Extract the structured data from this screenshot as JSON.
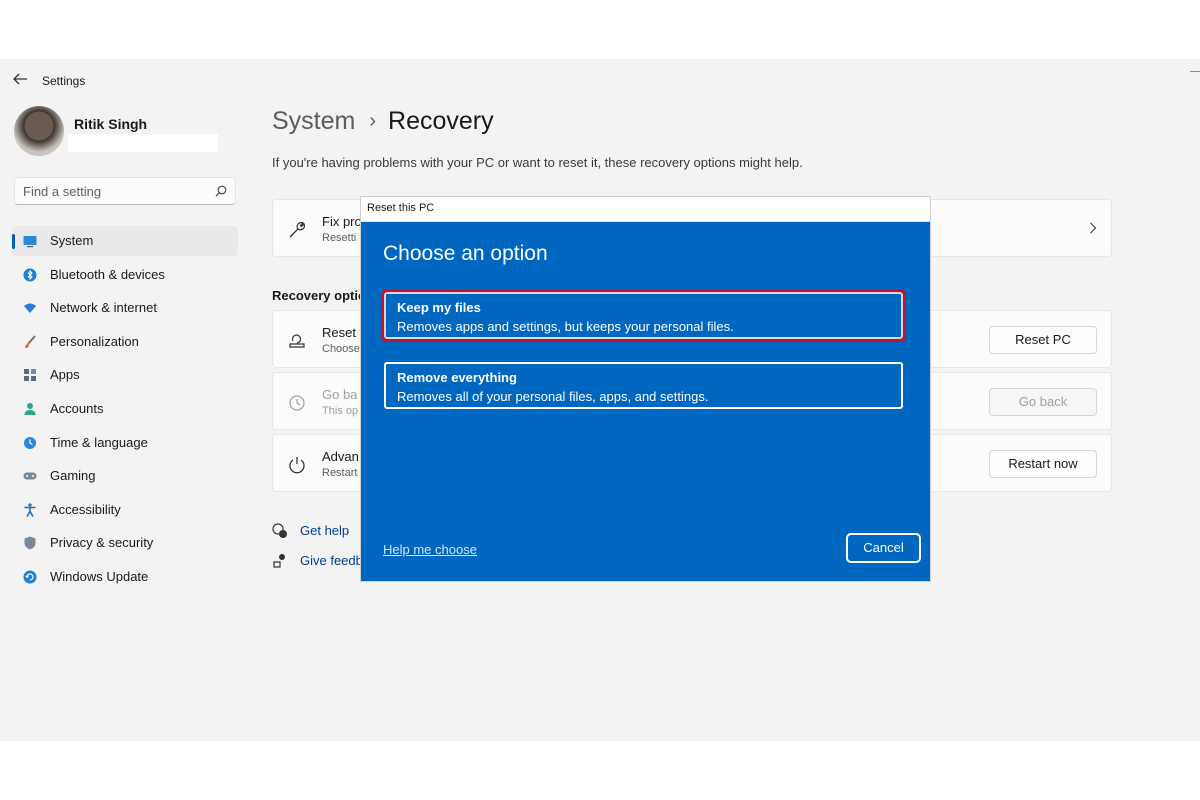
{
  "app": {
    "title": "Settings"
  },
  "user": {
    "name": "Ritik Singh"
  },
  "search": {
    "placeholder": "Find a setting"
  },
  "nav": {
    "items": [
      {
        "label": "System",
        "icon": "monitor-icon",
        "active": true
      },
      {
        "label": "Bluetooth & devices",
        "icon": "bluetooth-icon"
      },
      {
        "label": "Network & internet",
        "icon": "wifi-icon"
      },
      {
        "label": "Personalization",
        "icon": "brush-icon"
      },
      {
        "label": "Apps",
        "icon": "apps-icon"
      },
      {
        "label": "Accounts",
        "icon": "person-icon"
      },
      {
        "label": "Time & language",
        "icon": "globe-clock-icon"
      },
      {
        "label": "Gaming",
        "icon": "gamepad-icon"
      },
      {
        "label": "Accessibility",
        "icon": "accessibility-icon"
      },
      {
        "label": "Privacy & security",
        "icon": "shield-icon"
      },
      {
        "label": "Windows Update",
        "icon": "update-icon"
      }
    ]
  },
  "breadcrumb": {
    "parent": "System",
    "separator": "›",
    "current": "Recovery"
  },
  "subtitle": "If you're having problems with your PC or want to reset it, these recovery options might help.",
  "fix_card": {
    "title": "Fix pro",
    "desc": "Resetti"
  },
  "section_label": "Recovery optio",
  "recovery": {
    "reset": {
      "title": "Reset t",
      "desc": "Choose",
      "button": "Reset PC"
    },
    "goback": {
      "title": "Go ba",
      "desc": "This op",
      "button": "Go back"
    },
    "advanced": {
      "title": "Advan",
      "desc": "Restart",
      "button": "Restart now"
    }
  },
  "help": {
    "get_help": "Get help",
    "feedback": "Give feedb"
  },
  "dialog": {
    "window_title": "Reset this PC",
    "heading": "Choose an option",
    "options": [
      {
        "title": "Keep my files",
        "desc": "Removes apps and settings, but keeps your personal files."
      },
      {
        "title": "Remove everything",
        "desc": "Removes all of your personal files, apps, and settings."
      }
    ],
    "help_link": "Help me choose",
    "cancel": "Cancel"
  },
  "colors": {
    "accent": "#0067c0",
    "highlight": "#c8102e",
    "nav_indicator": "#005fb8"
  }
}
